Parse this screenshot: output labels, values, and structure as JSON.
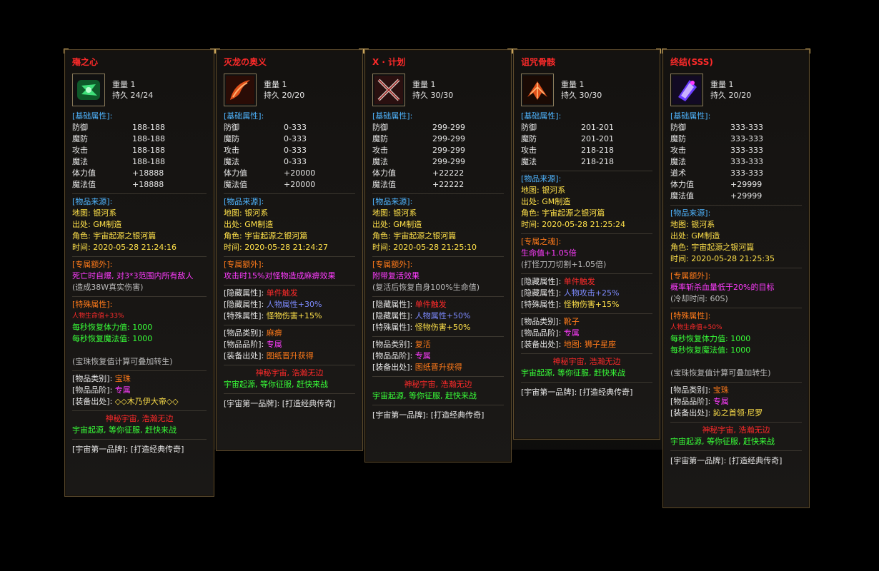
{
  "colors": {
    "red": "#ff2a2a",
    "yellow": "#ffe14a",
    "blue_header": "#4fb5ff",
    "magenta": "#ff3cff",
    "green": "#38ff38",
    "orange": "#ff7a1a",
    "blue": "#7d8bff",
    "border": "#5b4a2d"
  },
  "common": {
    "weight_label": "重量",
    "durability_label": "持久",
    "basic_attr_header": "[基础属性]:",
    "source_header": "[物品来源]:",
    "map_label": "地图:",
    "map_value": "银河系",
    "origin_label": "出处:",
    "origin_value": "GM制造",
    "role_label": "角色:",
    "role_value": "宇宙起源之银河篇",
    "time_label": "时间:",
    "exclusive_header": "[专属额外]:",
    "special_header": "[特殊属性]:",
    "hidden_attr_label": "[隐藏属性]:",
    "special_attr_label": "[特殊属性]:",
    "category_label": "[物品类别]:",
    "rank_label": "[物品品阶]:",
    "drop_label": "[装备出处]:",
    "slogan1": "神秘宇宙, 浩瀚无边",
    "slogan2": "宇宙起源, 等你征服, 赶快来战",
    "brand_label": "[宇宙第一品牌]:",
    "brand_value": "[打造经典传奇]"
  },
  "cards": [
    {
      "name": "殤之心",
      "icon": "green-gem-icon",
      "weight": "1",
      "durability": "24/24",
      "stats": [
        {
          "k": "防御",
          "v": "188-188"
        },
        {
          "k": "魔防",
          "v": "188-188"
        },
        {
          "k": "攻击",
          "v": "188-188"
        },
        {
          "k": "魔法",
          "v": "188-188"
        },
        {
          "k": "体力值",
          "v": "+18888"
        },
        {
          "k": "魔法值",
          "v": "+18888"
        }
      ],
      "time": "2020-05-28 21:24:16",
      "extra_header": "[专属额外]:",
      "extra_line": "死亡时自爆, 对3*3范围内所有敌人",
      "extra_note": "(造成38W真实伤害)",
      "special_lines": [
        "人物生命值+33%",
        "每秒恢复体力值: 1000",
        "每秒恢复魔法值: 1000"
      ],
      "note": "(宝珠恢复值计算可叠加转生)",
      "category": "宝珠",
      "rank": "专属",
      "drop": "◇◇木乃伊大帝◇◇"
    },
    {
      "name": "灭龙の奥义",
      "icon": "dragon-blade-icon",
      "weight": "1",
      "durability": "20/20",
      "stats": [
        {
          "k": "防御",
          "v": "0-333"
        },
        {
          "k": "魔防",
          "v": "0-333"
        },
        {
          "k": "攻击",
          "v": "0-333"
        },
        {
          "k": "魔法",
          "v": "0-333"
        },
        {
          "k": "体力值",
          "v": "+20000"
        },
        {
          "k": "魔法值",
          "v": "+20000"
        }
      ],
      "time": "2020-05-28 21:24:27",
      "extra_header": "[专属额外]:",
      "extra_line": "攻击时15%对怪物造成麻痹效果",
      "hidden_trigger": "单件触发",
      "hidden_attr": "人物属性+30%",
      "special_attr": "怪物伤害+15%",
      "category": "麻痹",
      "rank": "专属",
      "drop": "图纸晋升获得"
    },
    {
      "name": "X · 计划",
      "icon": "crossed-swords-icon",
      "weight": "1",
      "durability": "30/30",
      "stats": [
        {
          "k": "防御",
          "v": "299-299"
        },
        {
          "k": "魔防",
          "v": "299-299"
        },
        {
          "k": "攻击",
          "v": "299-299"
        },
        {
          "k": "魔法",
          "v": "299-299"
        },
        {
          "k": "体力值",
          "v": "+22222"
        },
        {
          "k": "魔法值",
          "v": "+22222"
        }
      ],
      "time": "2020-05-28 21:25:10",
      "extra_header": "[专属额外]:",
      "extra_line": "附带复活效果",
      "extra_note": "(复活后恢复自身100%生命值)",
      "hidden_trigger": "单件触发",
      "hidden_attr": "人物属性+50%",
      "special_attr": "怪物伤害+50%",
      "category": "复活",
      "rank": "专属",
      "drop": "图纸晋升获得"
    },
    {
      "name": "诅咒骨骸",
      "icon": "bone-wings-icon",
      "weight": "1",
      "durability": "30/30",
      "stats": [
        {
          "k": "防御",
          "v": "201-201"
        },
        {
          "k": "魔防",
          "v": "201-201"
        },
        {
          "k": "攻击",
          "v": "218-218"
        },
        {
          "k": "魔法",
          "v": "218-218"
        }
      ],
      "time": "2020-05-28 21:25:24",
      "extra_header": "[专属之魂]:",
      "extra_line": "生命值+1.05倍",
      "extra_note": "(打怪刀刀切割+1.05倍)",
      "hidden_trigger": "单件触发",
      "hidden_attr": "人物攻击+25%",
      "special_attr": "怪物伤害+15%",
      "category": "靴子",
      "rank": "专属",
      "drop": "地图: 狮子星座"
    },
    {
      "name": "终结(SSS)",
      "icon": "purple-crystal-icon",
      "weight": "1",
      "durability": "20/20",
      "stats": [
        {
          "k": "防御",
          "v": "333-333"
        },
        {
          "k": "魔防",
          "v": "333-333"
        },
        {
          "k": "攻击",
          "v": "333-333"
        },
        {
          "k": "魔法",
          "v": "333-333"
        },
        {
          "k": "道术",
          "v": "333-333"
        },
        {
          "k": "体力值",
          "v": "+29999"
        },
        {
          "k": "魔法值",
          "v": "+29999"
        }
      ],
      "time": "2020-05-28 21:25:35",
      "extra_header": "[专属额外]:",
      "extra_line": "概率斩杀血量低于20%的目标",
      "extra_note": "(冷却时间: 60S)",
      "special_lines": [
        "人物生命值+50%",
        "每秒恢复体力值: 1000",
        "每秒恢复魔法值: 1000"
      ],
      "note": "(宝珠恢复值计算可叠加转生)",
      "category": "宝珠",
      "rank": "专属",
      "drop": "訫之首领·尼罗"
    }
  ]
}
